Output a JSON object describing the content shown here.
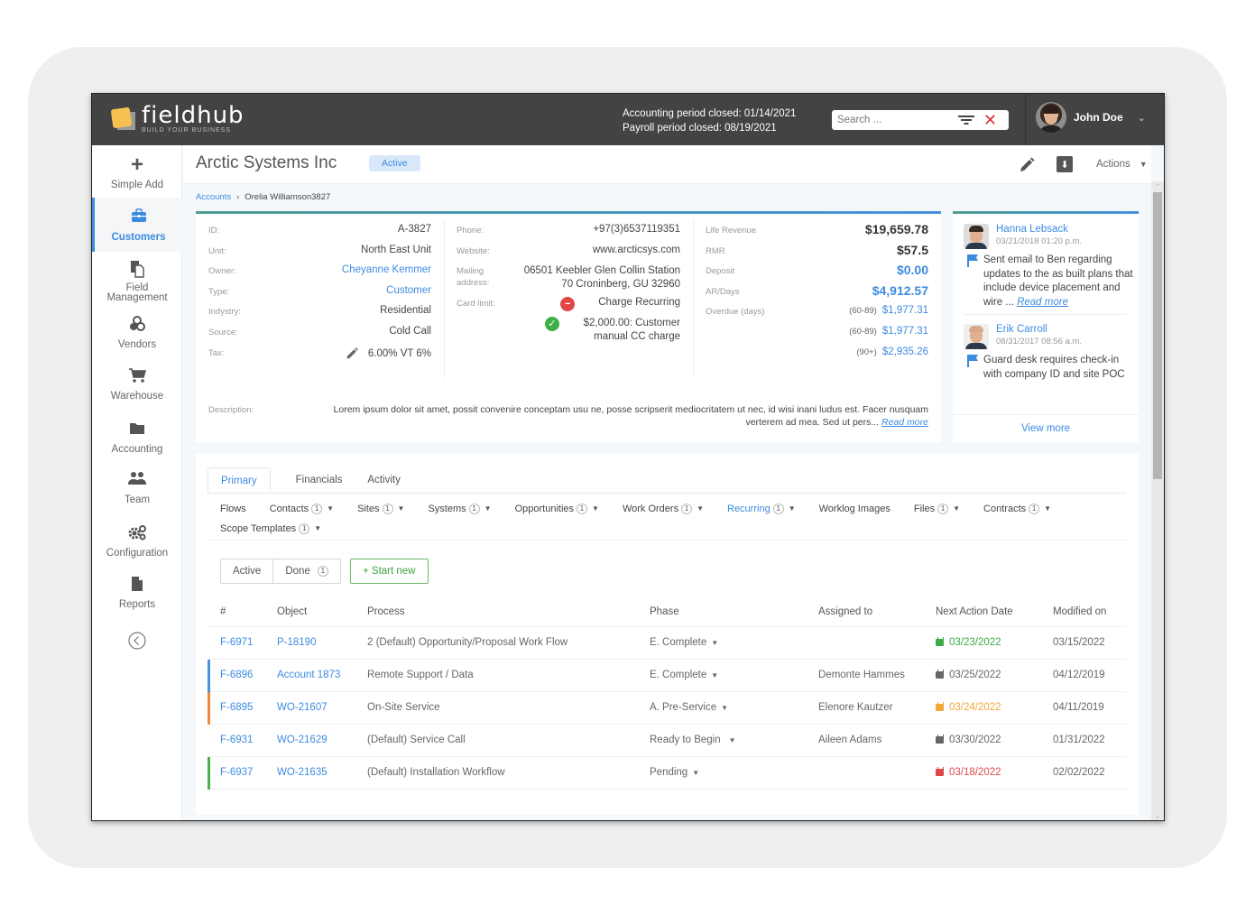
{
  "app": {
    "logo_name": "fieldhub",
    "logo_tagline": "BUILD YOUR BUSINESS",
    "accounting_period": "Accounting period closed: 01/14/2021",
    "payroll_period": "Payroll period closed: 08/19/2021",
    "search_placeholder": "Search ...",
    "user_name": "John Doe"
  },
  "sidebar": {
    "items": [
      {
        "label": "Simple Add",
        "icon": "plus-icon"
      },
      {
        "label": "Customers",
        "icon": "briefcase-icon",
        "active": true
      },
      {
        "label": "Field Management",
        "icon": "documents-icon"
      },
      {
        "label": "Vendors",
        "icon": "cubes-icon"
      },
      {
        "label": "Warehouse",
        "icon": "cart-icon"
      },
      {
        "label": "Accounting",
        "icon": "folder-icon"
      },
      {
        "label": "Team",
        "icon": "users-icon"
      },
      {
        "label": "Configuration",
        "icon": "gears-icon"
      },
      {
        "label": "Reports",
        "icon": "file-icon"
      }
    ],
    "collapse_icon": "chevron-left-circle-icon"
  },
  "header": {
    "title": "Arctic Systems Inc",
    "status": "Active",
    "actions_label": "Actions"
  },
  "breadcrumb": {
    "parent": "Accounts",
    "current": "Orelia Williamson3827"
  },
  "account": {
    "col1": [
      {
        "label": "ID:",
        "value": "A-3827"
      },
      {
        "label": "Unit:",
        "value": "North East Unit"
      },
      {
        "label": "Owner:",
        "value": "Cheyanne Kemmer",
        "link": true
      },
      {
        "label": "Type:",
        "value": "Customer",
        "link": true
      },
      {
        "label": "Indystry:",
        "value": "Residential"
      },
      {
        "label": "Source:",
        "value": "Cold Call"
      },
      {
        "label": "Tax:",
        "value": "6.00% VT 6%"
      }
    ],
    "col2": {
      "phone_label": "Phone:",
      "phone": "+97(3)6537119351",
      "website_label": "Website:",
      "website": "www.arcticsys.com",
      "mailing_label": "Mailing address:",
      "mailing_line1": "06501 Keebler Glen Collin Station",
      "mailing_line2": "70 Croninberg, GU 32960",
      "card_label": "Card limit:",
      "card_status_1": "Charge Recurring",
      "card_status_2": "$2,000.00: Customer manual CC charge"
    },
    "col3": {
      "life_revenue_label": "Life Revenue",
      "life_revenue": "$19,659.78",
      "rmr_label": "RMR",
      "rmr": "$57.5",
      "deposit_label": "Deposit",
      "deposit": "$0.00",
      "ar_label": "AR/Days",
      "ar": "$4,912.57",
      "overdue_label": "Overdue (days)",
      "overdue": [
        {
          "range": "(60-89)",
          "amount": "$1,977.31"
        },
        {
          "range": "(60-89)",
          "amount": "$1,977.31"
        },
        {
          "range": "(90+)",
          "amount": "$2,935.26"
        }
      ]
    },
    "description_label": "Description:",
    "description": "Lorem ipsum dolor sit amet, possit convenire conceptam usu ne, posse scripserit mediocritatem ut nec, id wisi inani ludus est. Facer nusquam verterem ad mea. Sed ut pers...",
    "read_more": "Read more"
  },
  "notes": {
    "items": [
      {
        "author": "Hanna Lebsack",
        "time": "03/21/2018   01:20 p.m.",
        "text": "Sent email to Ben regarding updates to the as built plans that include device placement and wire ...",
        "read_more": "Read more"
      },
      {
        "author": "Erik Carroll",
        "time": "08/31/2017  08:56 a.m.",
        "text": "Guard desk requires check-in with company ID and site POC"
      }
    ],
    "view_more": "View more"
  },
  "tabs": [
    {
      "label": "Primary",
      "active": true
    },
    {
      "label": "Financials"
    },
    {
      "label": "Activity"
    }
  ],
  "subtabs": [
    {
      "label": "Flows"
    },
    {
      "label": "Contacts",
      "count": "1",
      "dropdown": true
    },
    {
      "label": "Sites",
      "count": "1",
      "dropdown": true
    },
    {
      "label": "Systems",
      "count": "1",
      "dropdown": true
    },
    {
      "label": "Opportunities",
      "count": "1",
      "dropdown": true
    },
    {
      "label": "Work Orders",
      "count": "1",
      "dropdown": true
    },
    {
      "label": "Recurring",
      "count": "1",
      "dropdown": true,
      "active": true
    },
    {
      "label": "Worklog Images"
    },
    {
      "label": "Files",
      "count": "1",
      "dropdown": true
    },
    {
      "label": "Contracts",
      "count": "1",
      "dropdown": true
    },
    {
      "label": "Scope Templates",
      "count": "1",
      "dropdown": true
    }
  ],
  "filters": {
    "active_label": "Active",
    "done_label": "Done",
    "done_count": "1",
    "start_new_label": "+ Start new"
  },
  "table": {
    "columns": [
      "#",
      "Object",
      "Process",
      "Phase",
      "Assigned to",
      "Next Action Date",
      "Modified on"
    ],
    "rows": [
      {
        "id": "F-6971",
        "object": "P-18190",
        "process": "2 (Default) Opportunity/Proposal Work Flow",
        "phase": "E. Complete",
        "assigned": "",
        "next_date": "03/23/2022",
        "date_color": "#3daa48",
        "modified": "03/15/2022",
        "marker": ""
      },
      {
        "id": "F-6896",
        "object": "Account 1873",
        "process": "Remote Support / Data",
        "phase": "E. Complete",
        "assigned": "Demonte Hammes",
        "next_date": "03/25/2022",
        "date_color": "#666666",
        "modified": "04/12/2019",
        "marker": "#4a90e2"
      },
      {
        "id": "F-6895",
        "object": "WO-21607",
        "process": "On-Site Service",
        "phase": "A. Pre-Service",
        "assigned": "Elenore Kautzer",
        "next_date": "03/24/2022",
        "date_color": "#f0a838",
        "modified": "04/11/2019",
        "marker": "#f08a3a"
      },
      {
        "id": "F-6931",
        "object": "WO-21629",
        "process": "(Default) Service Call",
        "phase": "Ready to Begin",
        "assigned": "Aileen Adams",
        "next_date": "03/30/2022",
        "date_color": "#666666",
        "modified": "01/31/2022",
        "marker": ""
      },
      {
        "id": "F-6937",
        "object": "WO-21635",
        "process": "(Default) Installation Workflow",
        "phase": "Pending",
        "assigned": "",
        "next_date": "03/18/2022",
        "date_color": "#e04848",
        "modified": "02/02/2022",
        "marker": "#4caf50"
      }
    ]
  },
  "colors": {
    "accent": "#3d8be0",
    "topbar": "#434343",
    "success": "#3daa48",
    "danger": "#e04848",
    "warning": "#f0a838"
  }
}
